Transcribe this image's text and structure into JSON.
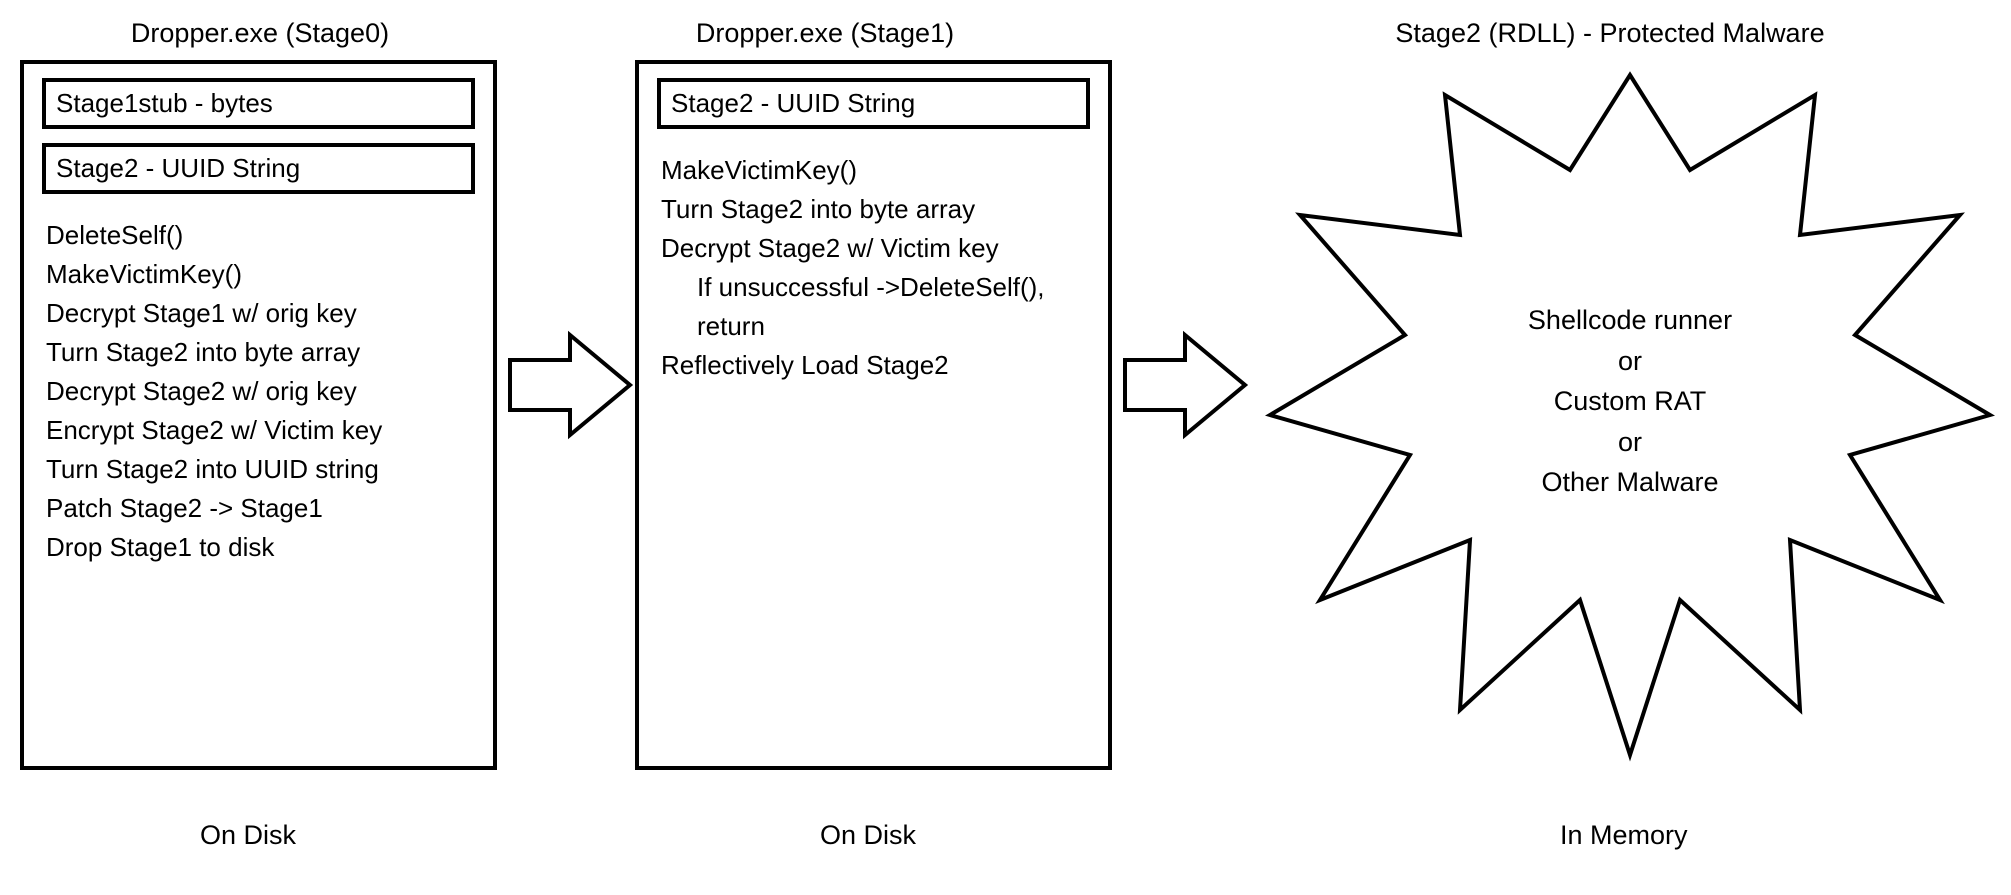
{
  "stage0": {
    "title": "Dropper.exe (Stage0)",
    "inner1": "Stage1stub - bytes",
    "inner2": "Stage2 - UUID String",
    "steps": [
      "DeleteSelf()",
      "MakeVictimKey()",
      "Decrypt Stage1 w/ orig key",
      "Turn Stage2 into byte array",
      "Decrypt Stage2 w/ orig key",
      "Encrypt Stage2 w/ Victim key",
      "Turn Stage2 into UUID string",
      "Patch Stage2 -> Stage1",
      "Drop Stage1 to disk"
    ],
    "location": "On Disk"
  },
  "stage1": {
    "title": "Dropper.exe (Stage1)",
    "inner1": "Stage2 - UUID String",
    "steps_flat": [
      "MakeVictimKey()",
      "Turn Stage2 into byte array",
      "Decrypt Stage2 w/ Victim key"
    ],
    "step_indent": "If unsuccessful ->DeleteSelf(), return",
    "step_after": "Reflectively Load Stage2",
    "location": "On Disk"
  },
  "stage2": {
    "title": "Stage2 (RDLL) - Protected Malware",
    "lines": [
      "Shellcode runner",
      "or",
      "Custom RAT",
      "or",
      "Other Malware"
    ],
    "location": "In Memory"
  }
}
